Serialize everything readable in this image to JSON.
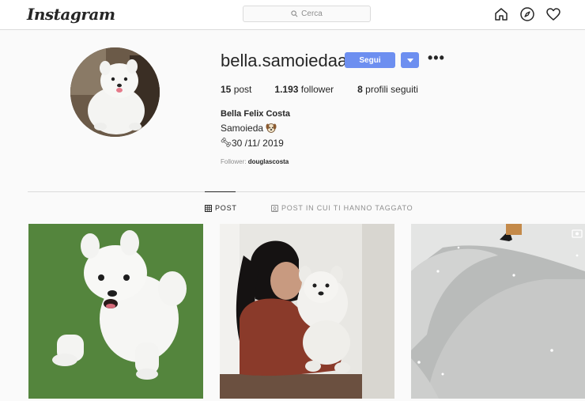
{
  "header": {
    "logo": "Instagram",
    "search_placeholder": "Cerca",
    "icons": [
      "home-icon",
      "explore-icon",
      "heart-icon"
    ]
  },
  "profile": {
    "username": "bella.samoiedaa",
    "follow_label": "Segui",
    "stats": [
      {
        "value": "15",
        "label": "post"
      },
      {
        "value": "1.193",
        "label": "follower"
      },
      {
        "value": "8",
        "label": "profili seguiti"
      }
    ],
    "full_name": "Bella Felix Costa",
    "bio_line1": "Samoieda",
    "bio_line2": "30 /11/ 2019",
    "followed_by_prefix": "Follower:",
    "followed_by_user": "douglascosta"
  },
  "tabs": [
    {
      "label": "POST",
      "icon": "grid-icon",
      "active": true
    },
    {
      "label": "POST IN CUI TI HANNO TAGGATO",
      "icon": "tag-icon",
      "active": false
    }
  ],
  "colors": {
    "accent": "#6d8ff0",
    "background": "#fafafa",
    "border": "#dbdbdb",
    "text": "#262626",
    "muted": "#8e8e8e"
  }
}
